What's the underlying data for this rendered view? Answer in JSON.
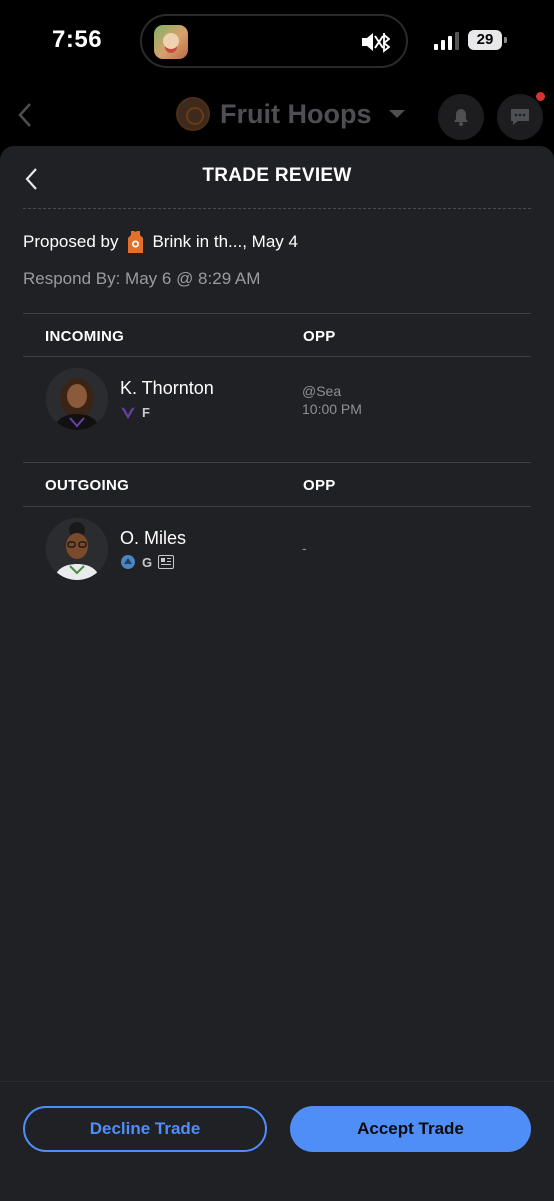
{
  "status_bar": {
    "time": "7:56",
    "battery": "29"
  },
  "background_header": {
    "league_name": "Fruit Hoops"
  },
  "sheet": {
    "title": "TRADE REVIEW",
    "proposed_by_prefix": "Proposed by",
    "proposer_team": "Brink in th..., May 4",
    "respond_by": "Respond By: May 6 @ 8:29 AM"
  },
  "incoming": {
    "header": "INCOMING",
    "opp_header": "OPP",
    "player": {
      "name": "K. Thornton",
      "position": "F",
      "opp_line1": "@Sea",
      "opp_line2": "10:00 PM"
    }
  },
  "outgoing": {
    "header": "OUTGOING",
    "opp_header": "OPP",
    "player": {
      "name": "O. Miles",
      "position": "G",
      "opp": "-"
    }
  },
  "actions": {
    "decline": "Decline Trade",
    "accept": "Accept Trade"
  },
  "colors": {
    "accent": "#4f8ef7",
    "sheet_bg": "#202124",
    "notification_dot": "#d6322f",
    "proposer_jersey": "#e2702a"
  },
  "icons": [
    "back-chevron-icon",
    "bell-icon",
    "chat-icon",
    "jersey-icon",
    "team-logo-icon",
    "news-icon",
    "mute-icon",
    "bluetooth-icon"
  ]
}
